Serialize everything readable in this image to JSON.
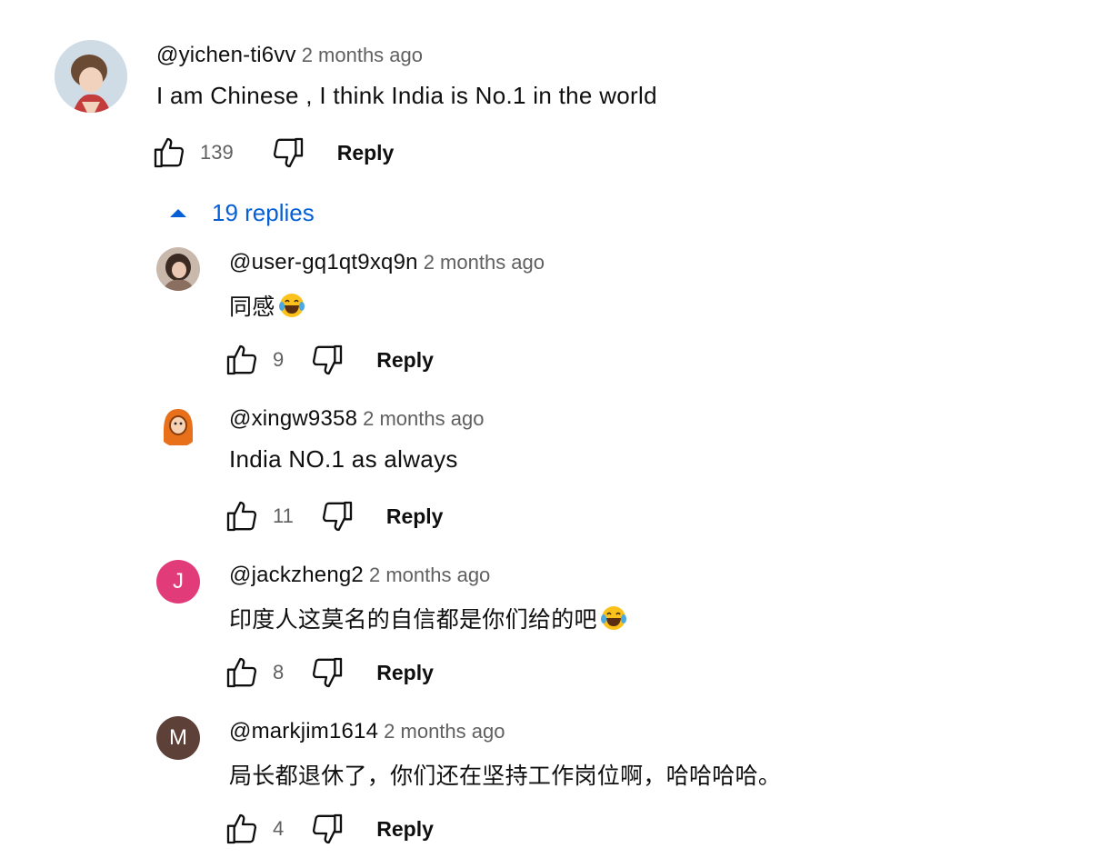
{
  "colors": {
    "link": "#065fd4",
    "secondary_text": "#606060",
    "avatar_j": "#e23b7a",
    "avatar_m": "#5d4037"
  },
  "main_comment": {
    "handle": "@yichen-ti6vv",
    "time": "2 months ago",
    "text": "I am Chinese , I think India is No.1 in the world",
    "likes": "139",
    "reply_label": "Reply"
  },
  "replies_toggle": {
    "label": "19 replies",
    "icon": "caret-up-icon"
  },
  "replies": [
    {
      "handle": "@user-gq1qt9xq9n",
      "time": "2 months ago",
      "text": "同感",
      "emoji": "laughing-tears-emoji",
      "likes": "9",
      "reply_label": "Reply",
      "avatar": "photo"
    },
    {
      "handle": "@xingw9358",
      "time": "2 months ago",
      "text": "India NO.1 as always",
      "likes": "11",
      "reply_label": "Reply",
      "avatar": "orange-hood-character"
    },
    {
      "handle": "@jackzheng2",
      "time": "2 months ago",
      "text": "印度人这莫名的自信都是你们给的吧",
      "emoji": "laughing-tears-emoji",
      "likes": "8",
      "reply_label": "Reply",
      "avatar_letter": "J"
    },
    {
      "handle": "@markjim1614",
      "time": "2 months ago",
      "text": "局长都退休了，你们还在坚持工作岗位啊，哈哈哈哈。",
      "likes": "4",
      "reply_label": "Reply",
      "avatar_letter": "M"
    }
  ]
}
